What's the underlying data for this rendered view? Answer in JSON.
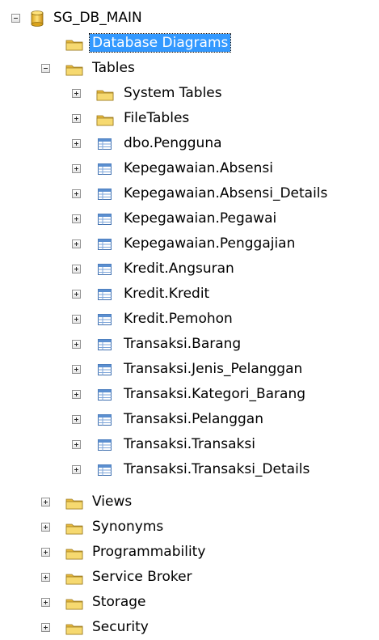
{
  "tree": {
    "root": {
      "label": "SG_DB_MAIN",
      "icon": "database-icon",
      "expanded": true
    },
    "diagrams": {
      "label": "Database Diagrams",
      "icon": "folder-icon",
      "selected": true
    },
    "tables": {
      "label": "Tables",
      "icon": "folder-icon",
      "expanded": true,
      "folders": [
        {
          "label": "System Tables",
          "icon": "folder-icon"
        },
        {
          "label": "FileTables",
          "icon": "folder-icon"
        }
      ],
      "items": [
        {
          "label": "dbo.Pengguna",
          "icon": "table-icon"
        },
        {
          "label": "Kepegawaian.Absensi",
          "icon": "table-icon"
        },
        {
          "label": "Kepegawaian.Absensi_Details",
          "icon": "table-icon"
        },
        {
          "label": "Kepegawaian.Pegawai",
          "icon": "table-icon"
        },
        {
          "label": "Kepegawaian.Penggajian",
          "icon": "table-icon"
        },
        {
          "label": "Kredit.Angsuran",
          "icon": "table-icon"
        },
        {
          "label": "Kredit.Kredit",
          "icon": "table-icon"
        },
        {
          "label": "Kredit.Pemohon",
          "icon": "table-icon"
        },
        {
          "label": "Transaksi.Barang",
          "icon": "table-icon"
        },
        {
          "label": "Transaksi.Jenis_Pelanggan",
          "icon": "table-icon"
        },
        {
          "label": "Transaksi.Kategori_Barang",
          "icon": "table-icon"
        },
        {
          "label": "Transaksi.Pelanggan",
          "icon": "table-icon"
        },
        {
          "label": "Transaksi.Transaksi",
          "icon": "table-icon"
        },
        {
          "label": "Transaksi.Transaksi_Details",
          "icon": "table-icon"
        }
      ]
    },
    "folders": [
      {
        "label": "Views",
        "icon": "folder-icon"
      },
      {
        "label": "Synonyms",
        "icon": "folder-icon"
      },
      {
        "label": "Programmability",
        "icon": "folder-icon"
      },
      {
        "label": "Service Broker",
        "icon": "folder-icon"
      },
      {
        "label": "Storage",
        "icon": "folder-icon"
      },
      {
        "label": "Security",
        "icon": "folder-icon"
      }
    ]
  },
  "colors": {
    "selection": "#3399ff",
    "folder": "#f0c850",
    "table_icon": "#4a7fc1"
  }
}
